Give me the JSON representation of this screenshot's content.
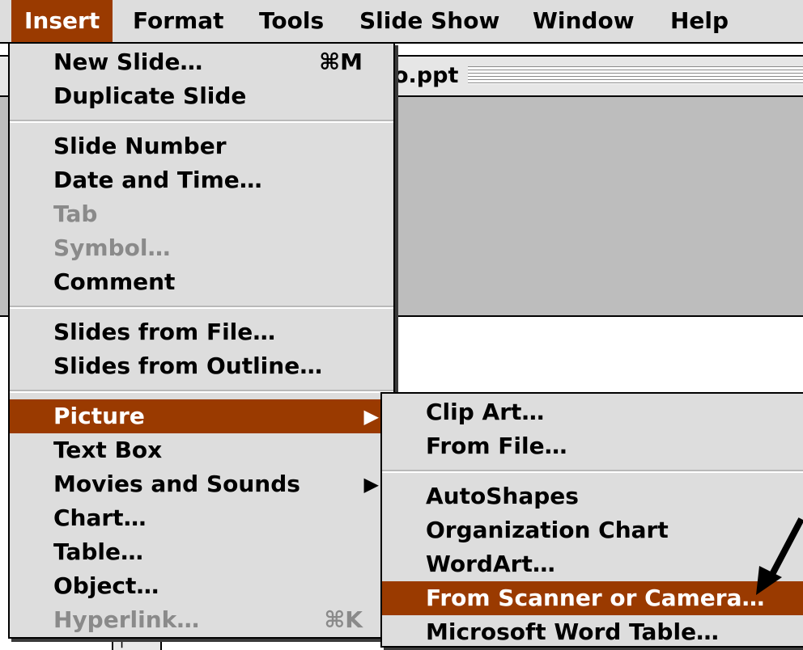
{
  "menubar": {
    "items": [
      {
        "label": "Insert",
        "active": true
      },
      {
        "label": "Format"
      },
      {
        "label": "Tools"
      },
      {
        "label": "Slide Show"
      },
      {
        "label": "Window"
      },
      {
        "label": "Help"
      }
    ]
  },
  "document": {
    "title": "o.ppt"
  },
  "insert_menu": {
    "groups": [
      [
        {
          "label": "New Slide…",
          "shortcut": "⌘M"
        },
        {
          "label": "Duplicate Slide"
        }
      ],
      [
        {
          "label": "Slide Number"
        },
        {
          "label": "Date and Time…"
        },
        {
          "label": "Tab",
          "disabled": true
        },
        {
          "label": "Symbol…",
          "disabled": true
        },
        {
          "label": "Comment"
        }
      ],
      [
        {
          "label": "Slides from File…"
        },
        {
          "label": "Slides from Outline…"
        }
      ],
      [
        {
          "label": "Picture",
          "submenu": true,
          "selected": true
        },
        {
          "label": "Text Box"
        },
        {
          "label": "Movies and Sounds",
          "submenu": true
        },
        {
          "label": "Chart…"
        },
        {
          "label": "Table…"
        },
        {
          "label": "Object…"
        },
        {
          "label": "Hyperlink…",
          "shortcut": "⌘K",
          "disabled": true
        }
      ]
    ]
  },
  "picture_submenu": {
    "groups": [
      [
        {
          "label": "Clip Art…"
        },
        {
          "label": "From File…"
        }
      ],
      [
        {
          "label": "AutoShapes"
        },
        {
          "label": "Organization Chart"
        },
        {
          "label": "WordArt…"
        },
        {
          "label": "From Scanner or Camera…",
          "selected": true
        },
        {
          "label": "Microsoft Word Table…"
        }
      ]
    ]
  },
  "colors": {
    "highlight": "#9a3a00",
    "menu_background": "#dddddd",
    "disabled_text": "#8a8a8a"
  }
}
